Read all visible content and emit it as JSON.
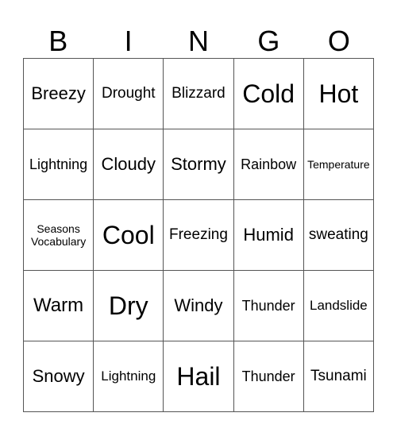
{
  "header": [
    "B",
    "I",
    "N",
    "G",
    "O"
  ],
  "rows": [
    [
      "Breezy",
      "Drought",
      "Blizzard",
      "Cold",
      "Hot"
    ],
    [
      "Lightning",
      "Cloudy",
      "Stormy",
      "Rainbow",
      "Temperature"
    ],
    [
      "Seasons Vocabulary",
      "Cool",
      "Freezing",
      "Humid",
      "sweating"
    ],
    [
      "Warm",
      "Dry",
      "Windy",
      "Thunder",
      "Landslide"
    ],
    [
      "Snowy",
      "Lightning",
      "Hail",
      "Thunder",
      "Tsunami"
    ]
  ]
}
